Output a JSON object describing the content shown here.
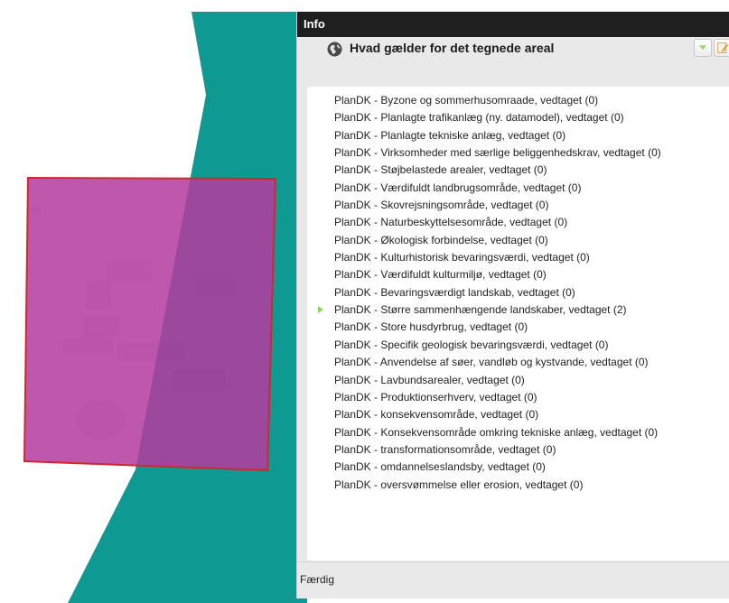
{
  "window": {
    "title": "Info"
  },
  "panel": {
    "title": "Hvad gælder for det tegnede areal",
    "icons": {
      "title_icon": "globe-icon",
      "zoom_button": "zoom-icon",
      "edit_button": "edit-icon"
    }
  },
  "results": [
    {
      "label": "PlanDK - Byzone og sommerhusomraade, vedtaget (0)",
      "expandable": false
    },
    {
      "label": "PlanDK - Planlagte trafikanlæg (ny. datamodel), vedtaget (0)",
      "expandable": false
    },
    {
      "label": "PlanDK - Planlagte tekniske anlæg, vedtaget (0)",
      "expandable": false
    },
    {
      "label": "PlanDK - Virksomheder med særlige beliggenhedskrav, vedtaget (0)",
      "expandable": false
    },
    {
      "label": "PlanDK - Støjbelastede arealer, vedtaget (0)",
      "expandable": false
    },
    {
      "label": "PlanDK - Værdifuldt landbrugsområde, vedtaget (0)",
      "expandable": false
    },
    {
      "label": "PlanDK - Skovrejsningsområde, vedtaget (0)",
      "expandable": false
    },
    {
      "label": "PlanDK - Naturbeskyttelsesområde, vedtaget (0)",
      "expandable": false
    },
    {
      "label": "PlanDK - Økologisk forbindelse, vedtaget (0)",
      "expandable": false
    },
    {
      "label": "PlanDK - Kulturhistorisk bevaringsværdi, vedtaget (0)",
      "expandable": false
    },
    {
      "label": "PlanDK - Værdifuldt kulturmiljø, vedtaget (0)",
      "expandable": false
    },
    {
      "label": "PlanDK - Bevaringsværdigt landskab, vedtaget (0)",
      "expandable": false
    },
    {
      "label": "PlanDK - Større sammenhængende landskaber, vedtaget (2)",
      "expandable": true
    },
    {
      "label": "PlanDK - Store husdyrbrug, vedtaget (0)",
      "expandable": false
    },
    {
      "label": "PlanDK - Specifik geologisk bevaringsværdi, vedtaget (0)",
      "expandable": false
    },
    {
      "label": "PlanDK - Anvendelse af søer, vandløb og kystvande, vedtaget (0)",
      "expandable": false
    },
    {
      "label": "PlanDK - Lavbundsarealer, vedtaget (0)",
      "expandable": false
    },
    {
      "label": "PlanDK - Produktionserhverv, vedtaget (0)",
      "expandable": false
    },
    {
      "label": "PlanDK - konsekvensområde, vedtaget (0)",
      "expandable": false
    },
    {
      "label": "PlanDK - Konsekvensområde omkring tekniske anlæg, vedtaget (0)",
      "expandable": false
    },
    {
      "label": "PlanDK - transformationsområde, vedtaget (0)",
      "expandable": false
    },
    {
      "label": "PlanDK - omdannelseslandsby, vedtaget (0)",
      "expandable": false
    },
    {
      "label": "PlanDK - oversvømmelse eller erosion, vedtaget (0)",
      "expandable": false
    }
  ],
  "footer": {
    "status": "Færdig"
  },
  "colors": {
    "teal_area": "#0e9a93",
    "drawn_polygon_fill": "#b4399f",
    "drawn_polygon_border": "#d0282f",
    "titlebar": "#1f1f1f",
    "expand_arrow": "#8fd15c"
  }
}
